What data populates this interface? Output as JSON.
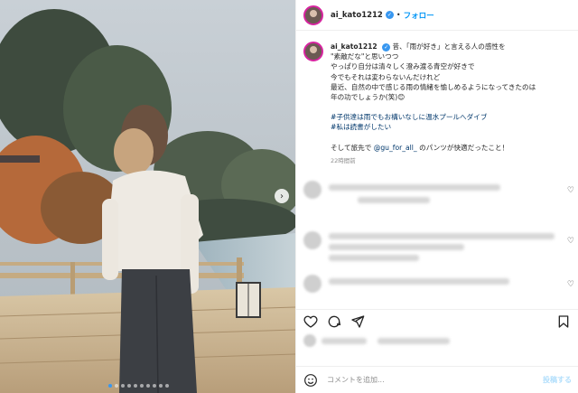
{
  "header": {
    "username": "ai_kato1212",
    "separator": "•",
    "follow_label": "フォロー"
  },
  "caption": {
    "username": "ai_kato1212",
    "lines": [
      "昔、「雨が好き」と言える人の感性を",
      "\"素敵だな\"と思いつつ",
      "やっぱり自分は清々しく澄み渡る青空が好きで",
      "今でもそれは変わらないんだけれど",
      "最近、自然の中で感じる雨の情緒を愉しめるようになってきたのは",
      "年の功でしょうか(笑)😊"
    ],
    "hashtags": [
      "#子供達は雨でもお構いなしに温水プールへダイブ",
      "#私は読書がしたい"
    ],
    "footer_before": "そして旅先で ",
    "mention": "@gu_for_all_",
    "footer_after": " のパンツが快適だったこと！",
    "time": "22時間前"
  },
  "comment_bar": {
    "placeholder": "コメントを追加...",
    "post_label": "投稿する"
  },
  "carousel": {
    "total": 10,
    "active_index": 0
  },
  "colors": {
    "accent": "#0095f6",
    "verified": "#3897f0",
    "link": "#00376b"
  },
  "icons": [
    "verified-badge-icon",
    "chevron-right-icon",
    "heart-icon",
    "comment-icon",
    "share-icon",
    "bookmark-icon",
    "emoji-icon"
  ]
}
